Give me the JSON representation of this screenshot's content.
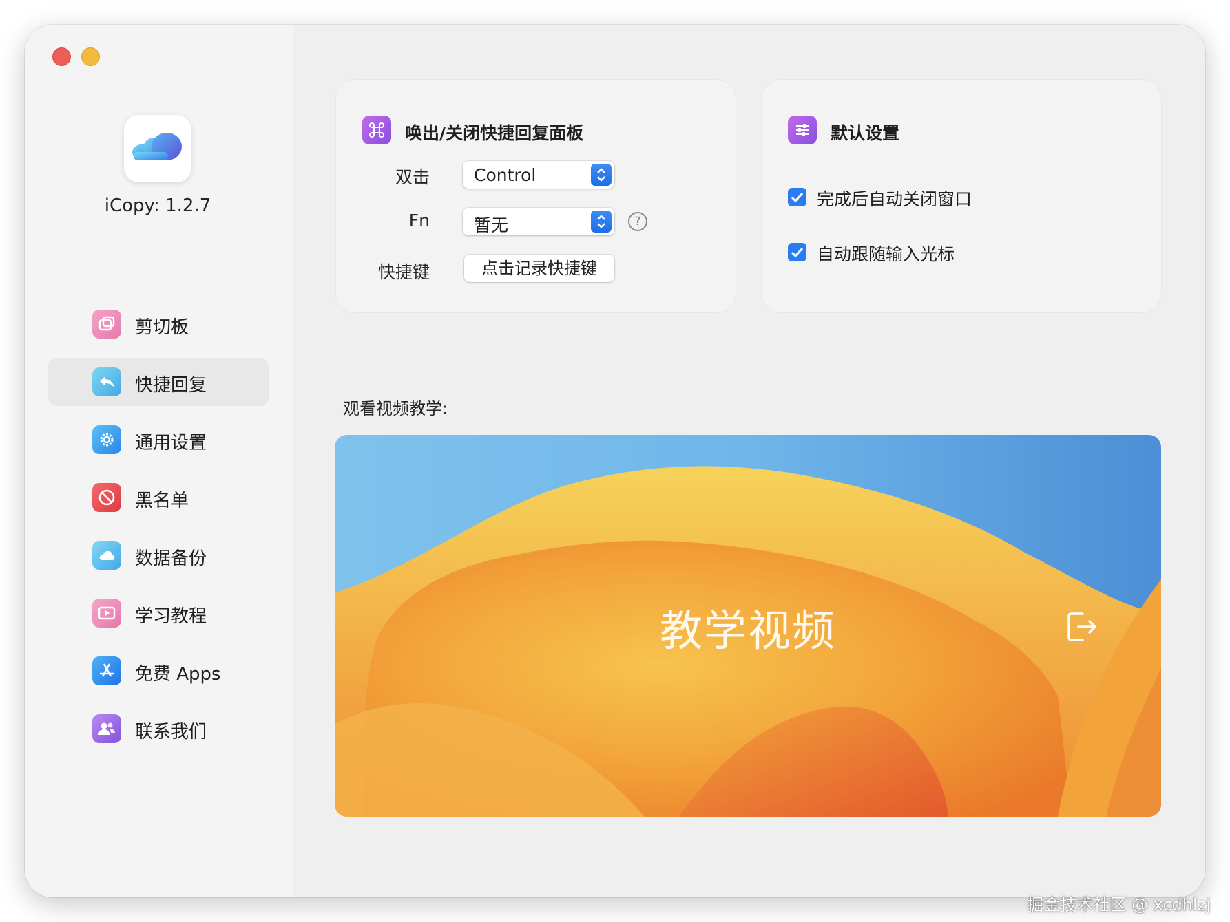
{
  "app": {
    "version_label": "iCopy: 1.2.7"
  },
  "sidebar": {
    "items": [
      {
        "label": "剪切板",
        "icon": "clipboard-icon",
        "color": "#e88ab8"
      },
      {
        "label": "快捷回复",
        "icon": "reply-icon",
        "color": "#5cc0e8",
        "active": true
      },
      {
        "label": "通用设置",
        "icon": "gear-icon",
        "color": "#3aa3f0"
      },
      {
        "label": "黑名单",
        "icon": "block-icon",
        "color": "#e8454a"
      },
      {
        "label": "数据备份",
        "icon": "cloud-icon",
        "color": "#58c0ec"
      },
      {
        "label": "学习教程",
        "icon": "video-icon",
        "color": "#ec86b4"
      },
      {
        "label": "免费 Apps",
        "icon": "app-store-icon",
        "color": "#2f8ef0"
      },
      {
        "label": "联系我们",
        "icon": "contacts-icon",
        "color": "#9a64e0"
      }
    ]
  },
  "hotkey_panel": {
    "title": "唤出/关闭快捷回复面板",
    "double_click_label": "双击",
    "double_click_value": "Control",
    "fn_label": "Fn",
    "fn_value": "暂无",
    "help_glyph": "?",
    "shortcut_label": "快捷键",
    "shortcut_button": "点击记录快捷键"
  },
  "defaults_panel": {
    "title": "默认设置",
    "options": [
      {
        "label": "完成后自动关闭窗口",
        "checked": true
      },
      {
        "label": "自动跟随输入光标",
        "checked": true
      }
    ]
  },
  "video": {
    "heading": "观看视频教学:",
    "title": "教学视频"
  },
  "watermark": "掘金技术社区 @ xcdhlzj",
  "colors": {
    "accent": "#2a7cf0",
    "window_bg": "#efefef",
    "sidebar_bg": "#f4f4f4"
  }
}
